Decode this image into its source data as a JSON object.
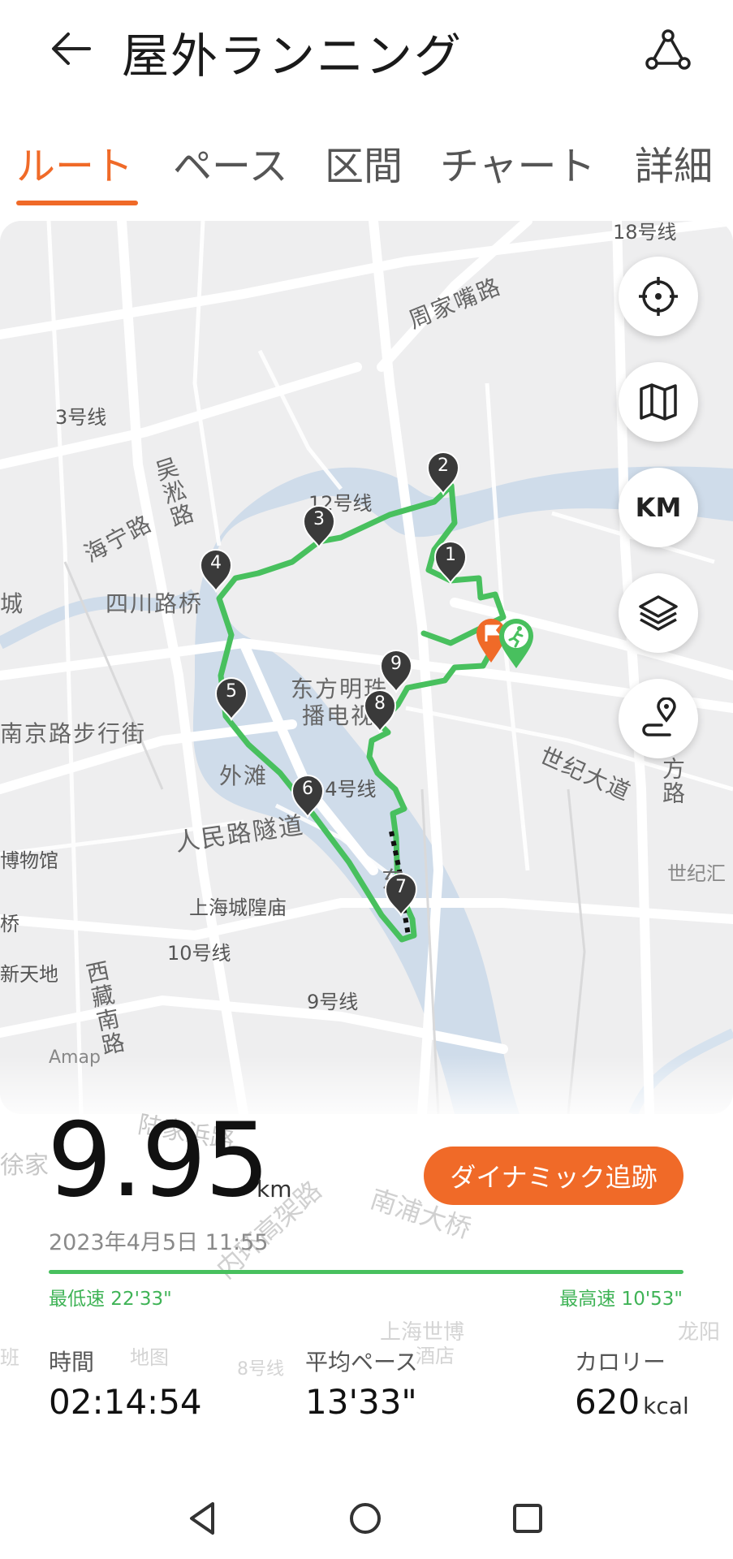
{
  "header": {
    "title": "屋外ランニング"
  },
  "tabs": [
    {
      "label": "ルート",
      "active": true
    },
    {
      "label": "ペース",
      "active": false
    },
    {
      "label": "区間",
      "active": false
    },
    {
      "label": "チャート",
      "active": false
    },
    {
      "label": "詳細",
      "active": false
    }
  ],
  "map": {
    "labels": [
      "18号线",
      "周家嘴路",
      "3号线",
      "吴淞路",
      "12号线",
      "海宁路",
      "四川路桥",
      "城",
      "东方明珠",
      "播电视",
      "南京路步行街",
      "外滩",
      "14号线",
      "世纪大道",
      "方路",
      "人民路隧道",
      "博物馆",
      "世纪汇",
      "上海城隍庙",
      "东",
      "桥",
      "10号线",
      "新天地",
      "西藏南路",
      "9号线"
    ],
    "attribution": "Amap",
    "markers": [
      "1",
      "2",
      "3",
      "4",
      "5",
      "6",
      "7",
      "8",
      "9"
    ],
    "background_labels": [
      "徐家",
      "陆家浜路",
      "内环高架路",
      "南浦大桥",
      "上海世博",
      "酒店",
      "龙阳",
      "8号线",
      "班",
      "地图"
    ]
  },
  "controls": {
    "km_label": "KM",
    "icons": [
      "locate-icon",
      "map-icon",
      "km-toggle",
      "layers-icon",
      "route-icon"
    ]
  },
  "summary": {
    "distance": "9.95",
    "distance_unit": "km",
    "dynamic_button": "ダイナミック追跡",
    "date": "2023年4月5日 11:55",
    "min_speed": "最低速 22'33\"",
    "max_speed": "最高速 10'53\"",
    "time_label": "時間",
    "time_value": "02:14:54",
    "pace_label": "平均ペース",
    "pace_value": "13'33\"",
    "calorie_label": "カロリー",
    "calorie_value": "620",
    "calorie_unit": "kcal"
  },
  "colors": {
    "accent": "#f06a28",
    "route": "#48c05e",
    "water": "#cfdcea",
    "marker": "#3a3a3a"
  }
}
